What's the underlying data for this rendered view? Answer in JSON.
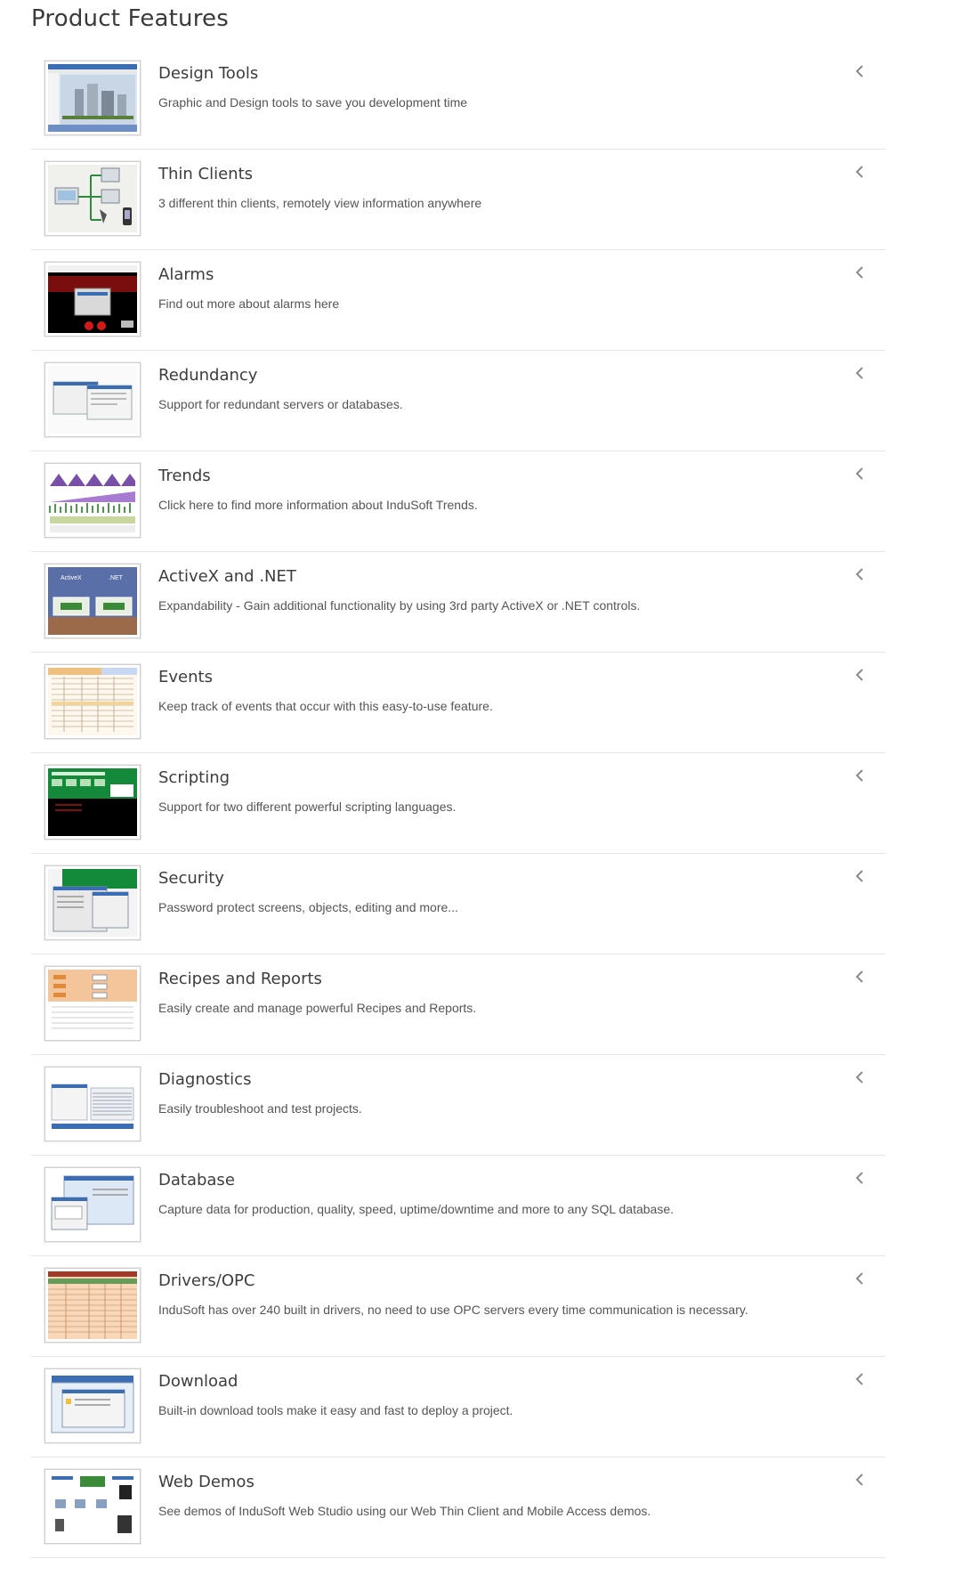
{
  "page": {
    "title": "Product Features"
  },
  "features": [
    {
      "title": "Design Tools",
      "description": "Graphic and Design tools to save you development time",
      "thumbnail": "design-tools"
    },
    {
      "title": "Thin Clients",
      "description": "3 different thin clients, remotely view information anywhere",
      "thumbnail": "thin-clients"
    },
    {
      "title": "Alarms",
      "description": "Find out more about alarms here",
      "thumbnail": "alarms"
    },
    {
      "title": "Redundancy",
      "description": "Support for redundant servers or databases.",
      "thumbnail": "redundancy"
    },
    {
      "title": "Trends",
      "description": "Click here to find more information about InduSoft Trends.",
      "thumbnail": "trends"
    },
    {
      "title": "ActiveX and .NET",
      "description": "Expandability - Gain additional functionality by using 3rd party ActiveX or .NET controls.",
      "thumbnail": "activex",
      "thumb_text": {
        "left": "ActiveX",
        "right": ".NET"
      }
    },
    {
      "title": "Events",
      "description": "Keep track of events that occur with this easy-to-use feature.",
      "thumbnail": "events"
    },
    {
      "title": "Scripting",
      "description": "Support for two different powerful scripting languages.",
      "thumbnail": "scripting"
    },
    {
      "title": "Security",
      "description": "Password protect screens, objects, editing and more...",
      "thumbnail": "security"
    },
    {
      "title": "Recipes and Reports",
      "description": "Easily create and manage powerful Recipes and Reports.",
      "thumbnail": "recipes"
    },
    {
      "title": "Diagnostics",
      "description": "Easily troubleshoot and test projects.",
      "thumbnail": "diagnostics"
    },
    {
      "title": "Database",
      "description": "Capture data for production, quality, speed, uptime/downtime and more to any SQL database.",
      "thumbnail": "database"
    },
    {
      "title": "Drivers/OPC",
      "description": "InduSoft has over 240 built in drivers, no need to use OPC servers every time communication is necessary.",
      "thumbnail": "drivers"
    },
    {
      "title": "Download",
      "description": "Built-in download tools make it easy and fast to deploy a project.",
      "thumbnail": "download"
    },
    {
      "title": "Web Demos",
      "description": "See demos of InduSoft Web Studio using our Web Thin Client and Mobile Access demos.",
      "thumbnail": "web-demos"
    }
  ],
  "icons": {
    "expand": "chevron-left-icon"
  },
  "colors": {
    "title": "#3a3a3a",
    "text": "#555555",
    "divider": "#e6e6e6",
    "chevron": "#8a8a8a"
  }
}
